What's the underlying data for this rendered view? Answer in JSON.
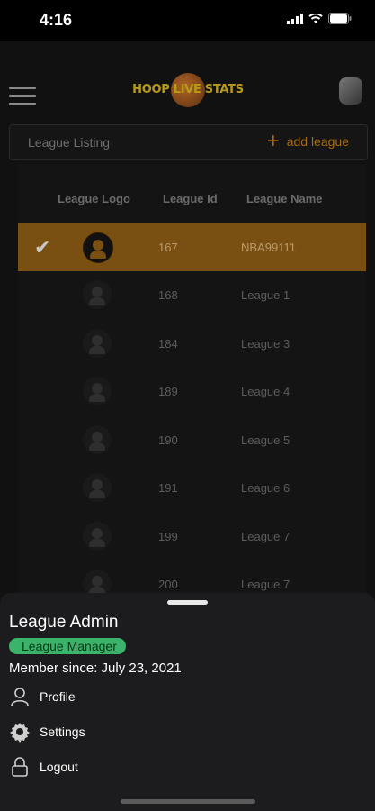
{
  "status_bar": {
    "time": "4:16"
  },
  "header": {
    "logo_text": "HOOP LIVE STATS"
  },
  "listing": {
    "title": "League Listing",
    "add_label": "add league"
  },
  "table": {
    "columns": [
      "League Logo",
      "League Id",
      "League Name"
    ],
    "rows": [
      {
        "id": "167",
        "name": "NBA99111",
        "selected": true
      },
      {
        "id": "168",
        "name": "League 1"
      },
      {
        "id": "184",
        "name": "League 3"
      },
      {
        "id": "189",
        "name": "League 4"
      },
      {
        "id": "190",
        "name": "League 5"
      },
      {
        "id": "191",
        "name": "League 6"
      },
      {
        "id": "199",
        "name": "League 7"
      },
      {
        "id": "200",
        "name": "League 7"
      }
    ]
  },
  "sheet": {
    "user_name": "League Admin",
    "role": "League Manager",
    "member_since": "Member since: July 23, 2021",
    "menu": [
      {
        "label": "Profile",
        "icon": "person-icon"
      },
      {
        "label": "Settings",
        "icon": "gear-icon"
      },
      {
        "label": "Logout",
        "icon": "lock-icon"
      }
    ]
  },
  "colors": {
    "accent": "#7a4f12",
    "badge": "#3bb36a"
  }
}
